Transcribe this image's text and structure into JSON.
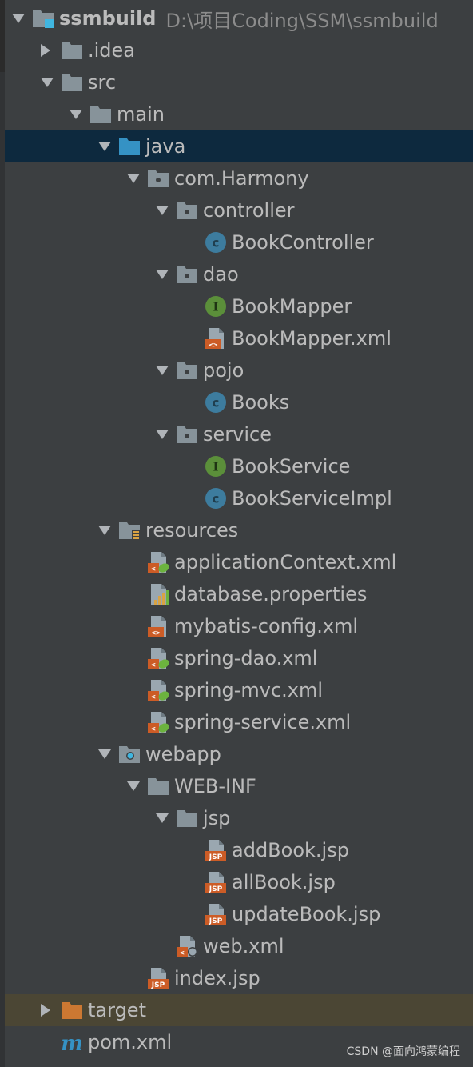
{
  "project": {
    "name": "ssmbuild",
    "path": "D:\\项目Coding\\SSM\\ssmbuild"
  },
  "tree": [
    {
      "label": "ssmbuild",
      "level": 0,
      "arrow": "down",
      "icon": "module-folder-icon",
      "bold": true
    },
    {
      "label": ".idea",
      "level": 1,
      "arrow": "right",
      "icon": "folder-icon"
    },
    {
      "label": "src",
      "level": 1,
      "arrow": "down",
      "icon": "folder-icon"
    },
    {
      "label": "main",
      "level": 2,
      "arrow": "down",
      "icon": "folder-icon"
    },
    {
      "label": "java",
      "level": 3,
      "arrow": "down",
      "icon": "source-root-folder-icon",
      "selected": true
    },
    {
      "label": "com.Harmony",
      "level": 4,
      "arrow": "down",
      "icon": "package-icon"
    },
    {
      "label": "controller",
      "level": 5,
      "arrow": "down",
      "icon": "package-icon"
    },
    {
      "label": "BookController",
      "level": 6,
      "arrow": "none",
      "icon": "class-icon"
    },
    {
      "label": "dao",
      "level": 5,
      "arrow": "down",
      "icon": "package-icon"
    },
    {
      "label": "BookMapper",
      "level": 6,
      "arrow": "none",
      "icon": "interface-icon"
    },
    {
      "label": "BookMapper.xml",
      "level": 6,
      "arrow": "none",
      "icon": "xml-file-icon"
    },
    {
      "label": "pojo",
      "level": 5,
      "arrow": "down",
      "icon": "package-icon"
    },
    {
      "label": "Books",
      "level": 6,
      "arrow": "none",
      "icon": "class-icon"
    },
    {
      "label": "service",
      "level": 5,
      "arrow": "down",
      "icon": "package-icon"
    },
    {
      "label": "BookService",
      "level": 6,
      "arrow": "none",
      "icon": "interface-icon"
    },
    {
      "label": "BookServiceImpl",
      "level": 6,
      "arrow": "none",
      "icon": "class-icon"
    },
    {
      "label": "resources",
      "level": 3,
      "arrow": "down",
      "icon": "resources-folder-icon"
    },
    {
      "label": "applicationContext.xml",
      "level": 4,
      "arrow": "none",
      "icon": "spring-xml-icon"
    },
    {
      "label": "database.properties",
      "level": 4,
      "arrow": "none",
      "icon": "properties-file-icon"
    },
    {
      "label": "mybatis-config.xml",
      "level": 4,
      "arrow": "none",
      "icon": "xml-file-icon"
    },
    {
      "label": "spring-dao.xml",
      "level": 4,
      "arrow": "none",
      "icon": "spring-xml-icon"
    },
    {
      "label": "spring-mvc.xml",
      "level": 4,
      "arrow": "none",
      "icon": "spring-xml-icon"
    },
    {
      "label": "spring-service.xml",
      "level": 4,
      "arrow": "none",
      "icon": "spring-xml-icon"
    },
    {
      "label": "webapp",
      "level": 3,
      "arrow": "down",
      "icon": "web-folder-icon"
    },
    {
      "label": "WEB-INF",
      "level": 4,
      "arrow": "down",
      "icon": "folder-icon"
    },
    {
      "label": "jsp",
      "level": 5,
      "arrow": "down",
      "icon": "folder-icon"
    },
    {
      "label": "addBook.jsp",
      "level": 6,
      "arrow": "none",
      "icon": "jsp-file-icon"
    },
    {
      "label": "allBook.jsp",
      "level": 6,
      "arrow": "none",
      "icon": "jsp-file-icon"
    },
    {
      "label": "updateBook.jsp",
      "level": 6,
      "arrow": "none",
      "icon": "jsp-file-icon"
    },
    {
      "label": "web.xml",
      "level": 5,
      "arrow": "none",
      "icon": "web-xml-icon"
    },
    {
      "label": "index.jsp",
      "level": 4,
      "arrow": "none",
      "icon": "jsp-file-icon"
    },
    {
      "label": "target",
      "level": 1,
      "arrow": "right",
      "icon": "excluded-folder-icon",
      "excluded": true
    },
    {
      "label": "pom.xml",
      "level": 1,
      "arrow": "none",
      "icon": "maven-pom-icon"
    }
  ],
  "watermark": "CSDN @面向鸿蒙编程",
  "colors": {
    "background": "#3c3f41",
    "selection": "#0d293e",
    "excluded_row": "#4b4634",
    "text": "#bbbbbb",
    "folder": "#87939a",
    "source_folder": "#3592c4",
    "class": "#3d7c9e",
    "interface": "#5b8f3a",
    "xml": "#cc5c26",
    "excluded_folder": "#cc7832"
  }
}
